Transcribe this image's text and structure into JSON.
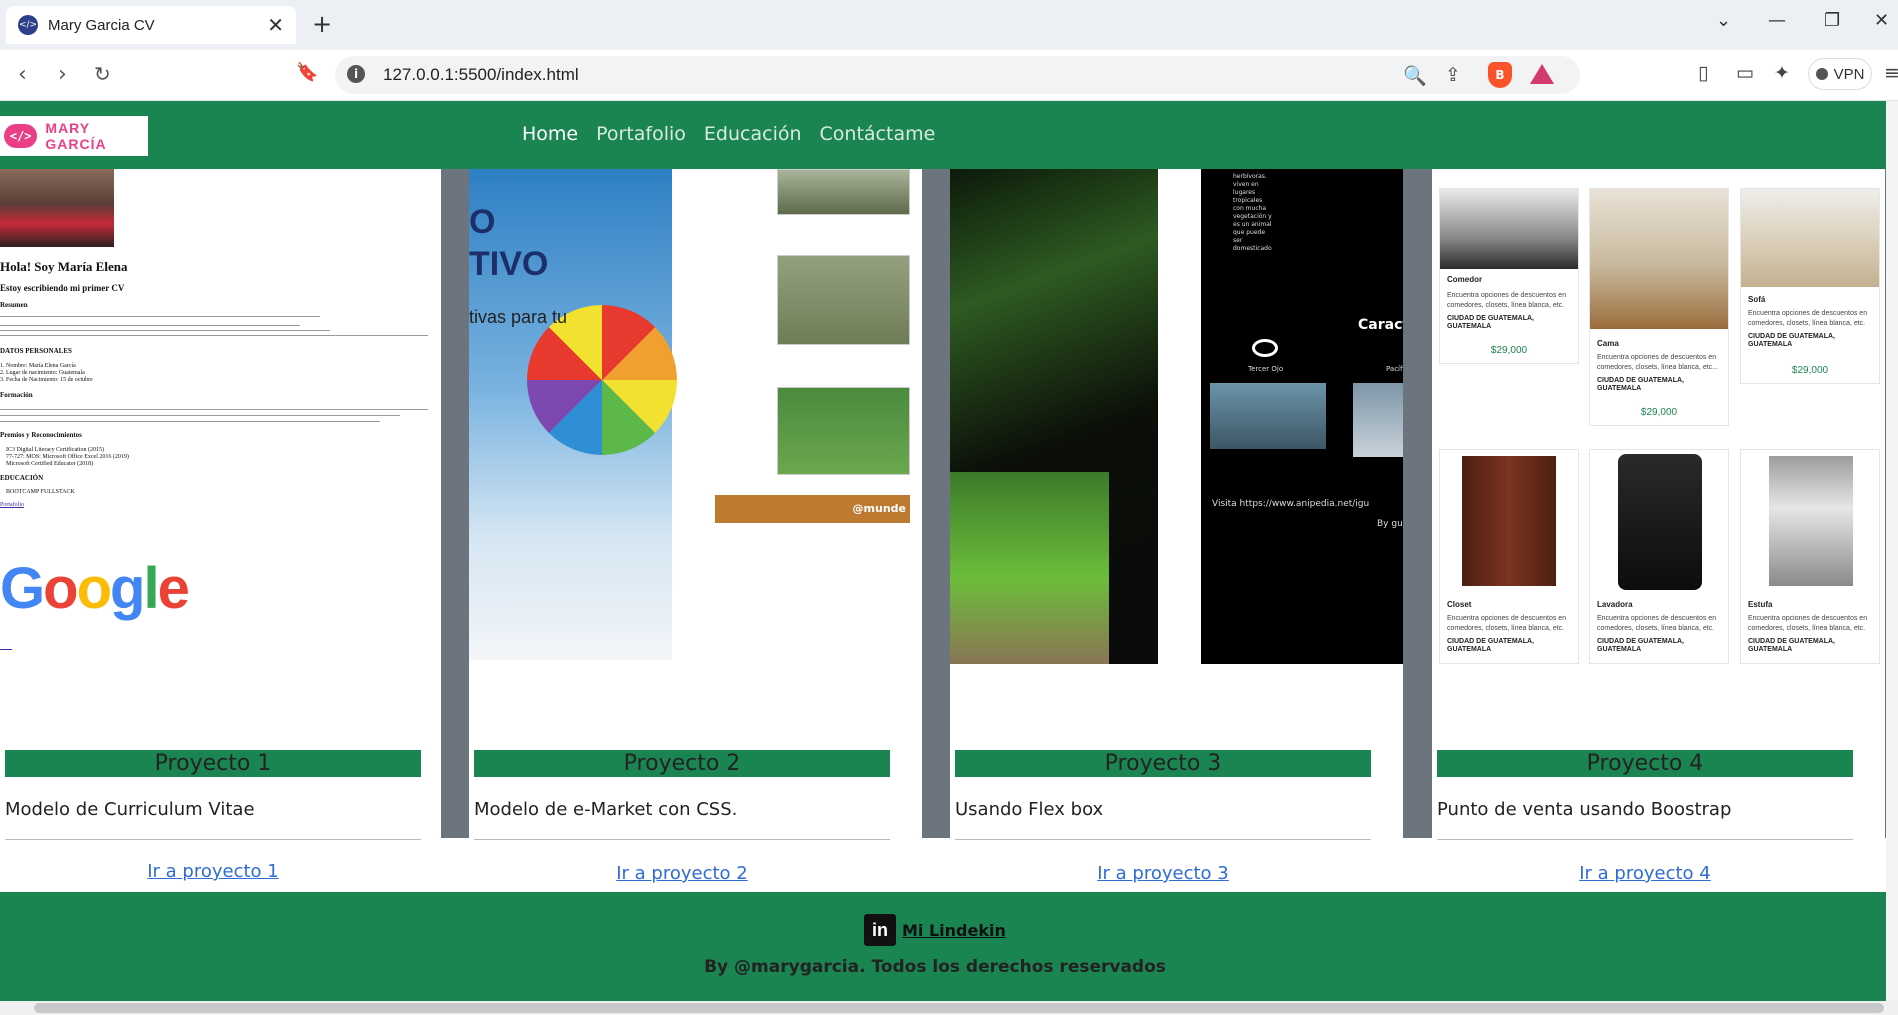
{
  "browser": {
    "tab_title": "Mary Garcia CV",
    "url": "127.0.0.1:5500/index.html",
    "vpn_label": "VPN"
  },
  "site": {
    "logo_text": "MARY GARCÍA",
    "nav": [
      "Home",
      "Portafolio",
      "Educación",
      "Contáctame"
    ],
    "active_nav": "Home",
    "accent_color": "#1b8551",
    "link_color": "#2f6cd6"
  },
  "projects": [
    {
      "title": "Proyecto 1",
      "description": "Modelo de Curriculum Vitae",
      "link": "Ir a proyecto 1",
      "preview": {
        "greeting": "Hola! Soy María Elena",
        "subtitle": "Estoy escribiendo mi primer CV",
        "section_summary": "Resumen",
        "section_personal": "DATOS PERSONALES",
        "personal_items": [
          "1. Nombre: María Elena García",
          "2. Lugar de nacimiento: Guatemala",
          "3. Fecha de Nacimiento: 15 de octubre"
        ],
        "section_training": "Formación",
        "section_awards": "Premios y Reconocimientos",
        "awards": [
          "IC3 Digital Literacy Certification (2015)",
          "77-727: MOS: Microsoft Office Excel 2016 (2019)",
          "Microsoft Certified Educator (2018)"
        ],
        "section_education": "EDUCACIÓN",
        "education_items": [
          "BOOTCAMP FULLSTACK"
        ],
        "portfolio_link": "Portafolio",
        "google_text": "Google"
      }
    },
    {
      "title": "Proyecto 2",
      "description": "Modelo de e-Market con CSS.",
      "link": "Ir a proyecto 2",
      "preview": {
        "headline_1": "O",
        "headline_2": "TIVO",
        "tagline": "tivas para tu",
        "banner": "@munde"
      }
    },
    {
      "title": "Proyecto 3",
      "description": "Usando Flex box",
      "link": "Ir a proyecto 3",
      "preview": {
        "small_text": "herbívoras. viven en lugares tropicales con mucha vegetación y es un animal que puede ser domesticado",
        "caption": "Caract",
        "feature": "Tercer Ojo",
        "feature_2": "Pacífi",
        "footer": "Visita https://www.anipedia.net/igu",
        "byline": "By gu"
      }
    },
    {
      "title": "Proyecto 4",
      "description": "Punto de venta usando Boostrap",
      "link": "Ir a proyecto 4",
      "preview": {
        "products": [
          {
            "name": "Comedor",
            "desc": "Encuentra opciones de descuentos en comedores, closets, línea blanca, etc.",
            "loc": "CIUDAD DE GUATEMALA, GUATEMALA",
            "price": "$29,000"
          },
          {
            "name": "Cama",
            "desc": "Encuentra opciones de descuentos en comedores, closets, línea blanca, etc...",
            "loc": "CIUDAD DE GUATEMALA, GUATEMALA",
            "price": "$29,000"
          },
          {
            "name": "Sofá",
            "desc": "Encuentra opciones de descuentos en comedores, closets, línea blanca, etc.",
            "loc": "CIUDAD DE GUATEMALA, GUATEMALA",
            "price": "$29,000"
          },
          {
            "name": "Closet",
            "desc": "Encuentra opciones de descuentos en comedores, closets, línea blanca, etc.",
            "loc": "CIUDAD DE GUATEMALA, GUATEMALA"
          },
          {
            "name": "Lavadora",
            "desc": "Encuentra opciones de descuentos en comedores, closets, línea blanca, etc.",
            "loc": "CIUDAD DE GUATEMALA, GUATEMALA"
          },
          {
            "name": "Estufa",
            "desc": "Encuentra opciones de descuentos en comedores, closets, línea blanca, etc.",
            "loc": "CIUDAD DE GUATEMALA, GUATEMALA"
          }
        ]
      }
    }
  ],
  "footer": {
    "linkedin_label": "Mi Lindekin",
    "copyright": "By @marygarcia. Todos los derechos reservados"
  }
}
